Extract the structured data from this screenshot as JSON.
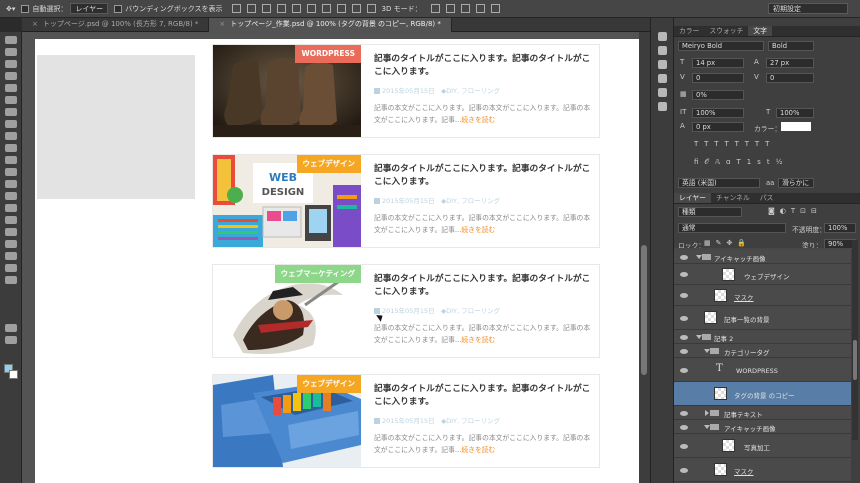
{
  "options_bar": {
    "auto_select_label": "自動選択：",
    "auto_select_value": "レイヤー",
    "bounding_box_label": "バウンディングボックスを表示",
    "mode_3d_label": "3D モード：",
    "workspace": "初期設定"
  },
  "doc_tabs": [
    {
      "label": "トップページ.psd @ 100% (長方形 7, RGB/8) *"
    },
    {
      "label": "トップページ_作業.psd @ 100% (タグの背景 のコピー, RGB/8) *"
    }
  ],
  "articles": [
    {
      "category": "WORDPRESS",
      "category_color": "#e96b5a",
      "title": "記事のタイトルがここに入ります。記事のタイトルがここに入ります。",
      "date": "2015年05月15日",
      "tags": "DIY, フローリング",
      "excerpt": "記事の本文がここに入ります。記事の本文がここに入ります。記事の本文がここに入ります。記事...",
      "more": "続きを読む"
    },
    {
      "category": "ウェブデザイン",
      "category_color": "#f5a623",
      "title": "記事のタイトルがここに入ります。記事のタイトルがここに入ります。",
      "date": "2015年05月15日",
      "tags": "DIY, フローリング",
      "excerpt": "記事の本文がここに入ります。記事の本文がここに入ります。記事の本文がここに入ります。記事...",
      "more": "続きを読む"
    },
    {
      "category": "ウェブマーケティング",
      "category_color": "#8dd68a",
      "title": "記事のタイトルがここに入ります。記事のタイトルがここに入ります。",
      "date": "2015年05月15日",
      "tags": "DIY, フローリング",
      "excerpt": "記事の本文がここに入ります。記事の本文がここに入ります。記事の本文がここに入ります。記事...",
      "more": "続きを読む"
    },
    {
      "category": "ウェブデザイン",
      "category_color": "#f5a623",
      "title": "記事のタイトルがここに入ります。記事のタイトルがここに入ります。",
      "date": "2015年05月15日",
      "tags": "DIY, フローリング",
      "excerpt": "記事の本文がここに入ります。記事の本文がここに入ります。記事の本文がここに入ります。記事...",
      "more": "続きを読む"
    }
  ],
  "thumb2_text": {
    "line1": "WEB",
    "line2": "DESIGN"
  },
  "char_panel": {
    "tabs": [
      "カラー",
      "スウォッチ",
      "文字"
    ],
    "font_family": "Meiryo Bold",
    "font_style": "Bold",
    "font_size": "14 px",
    "leading": "27 px",
    "kerning": "0",
    "tracking": "0",
    "tsume": "0%",
    "vscale": "100%",
    "hscale": "100%",
    "baseline": "0 px",
    "color_label": "カラー：",
    "language": "英語 (米国)",
    "aa_label": "aa",
    "antialias": "滑らかに"
  },
  "layers_panel": {
    "tabs": [
      "レイヤー",
      "チャンネル",
      "パス"
    ],
    "filter": "種類",
    "blend_mode": "通常",
    "opacity_label": "不透明度：",
    "opacity": "100%",
    "lock_label": "ロック：",
    "fill_label": "塗り：",
    "fill": "90%",
    "layers": [
      {
        "name": "アイキャッチ画像"
      },
      {
        "name": "ウェブデザイン"
      },
      {
        "name": "マスク"
      },
      {
        "name": "記事一覧の背景"
      },
      {
        "name": "記事 2"
      },
      {
        "name": "カテゴリータグ"
      },
      {
        "name": "WORDPRESS"
      },
      {
        "name": "タグの背景 のコピー"
      },
      {
        "name": "記事テキスト"
      },
      {
        "name": "アイキャッチ画像"
      },
      {
        "name": "写真加工"
      },
      {
        "name": "マスク"
      }
    ]
  }
}
